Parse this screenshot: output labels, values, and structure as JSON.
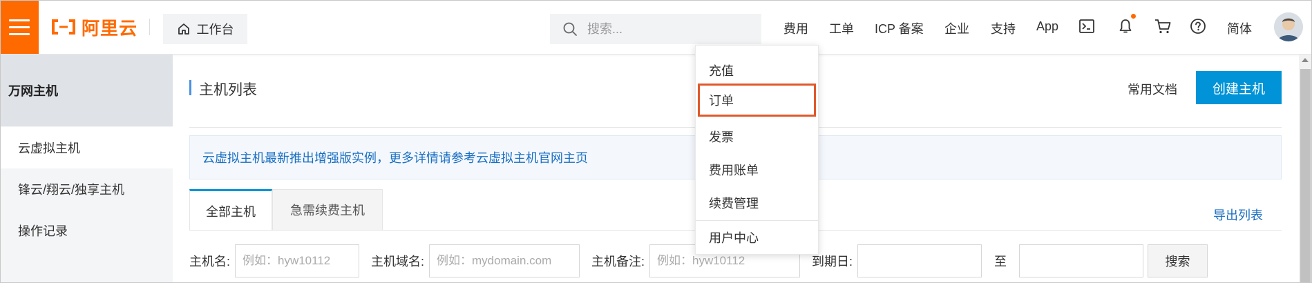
{
  "header": {
    "logo_text": "阿里云",
    "workbench_label": "工作台",
    "search_placeholder": "搜索...",
    "nav": [
      "费用",
      "工单",
      "ICP 备案",
      "企业",
      "支持",
      "App"
    ],
    "language": "简体",
    "accent_color": "#ff6a00",
    "icons": [
      "terminal-icon",
      "bell-icon",
      "cart-icon",
      "help-icon"
    ]
  },
  "sidebar": {
    "title": "万网主机",
    "items": [
      {
        "label": "云虚拟主机"
      },
      {
        "label": "锋云/翔云/独享主机"
      },
      {
        "label": "操作记录"
      }
    ]
  },
  "main": {
    "title": "主机列表",
    "docs_link": "常用文档",
    "create_button": "创建主机",
    "notice": "云虚拟主机最新推出增强版实例，更多详情请参考云虚拟主机官网主页",
    "tabs": [
      "全部主机",
      "急需续费主机"
    ],
    "export_link": "导出列表",
    "filters": {
      "host_name_label": "主机名:",
      "host_name_placeholder": "例如：hyw10112",
      "domain_label": "主机域名:",
      "domain_placeholder": "例如：mydomain.com",
      "remark_label": "主机备注:",
      "remark_placeholder": "例如：hyw10112",
      "expire_label": "到期日:",
      "to_label": "至",
      "search_button": "搜索"
    }
  },
  "dropdown": {
    "items": [
      "充值",
      "订单",
      "发票",
      "费用账单",
      "续费管理",
      "用户中心"
    ],
    "highlighted": "订单",
    "highlight_color": "#e0582a"
  }
}
